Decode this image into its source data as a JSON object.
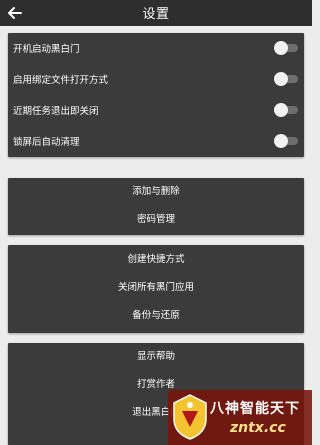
{
  "header": {
    "title": "设置",
    "back_icon": "back-arrow-icon"
  },
  "toggles": [
    {
      "label": "开机启动黑白门",
      "enabled": false
    },
    {
      "label": "启用绑定文件打开方式",
      "enabled": false
    },
    {
      "label": "近期任务退出即关闭",
      "enabled": false
    },
    {
      "label": "锁屏后自动清理",
      "enabled": false
    }
  ],
  "menu_group_1": [
    "添加与删除",
    "密码管理"
  ],
  "menu_group_2": [
    "创建快捷方式",
    "关闭所有黑门应用",
    "备份与还原"
  ],
  "menu_group_3": [
    "显示帮助",
    "打赏作者",
    "退出黑白门"
  ],
  "watermark": {
    "text": "八神智能天下",
    "url": "zntx.cc"
  },
  "colors": {
    "background": "#ececec",
    "appbar": "#2e2e2e",
    "card": "#3b3b3b",
    "text": "#ffffff",
    "switch_track": "#6e6e6e",
    "switch_thumb": "#f2f2f2",
    "watermark_bg": "#78140a",
    "watermark_accent": "#ffe08a"
  }
}
